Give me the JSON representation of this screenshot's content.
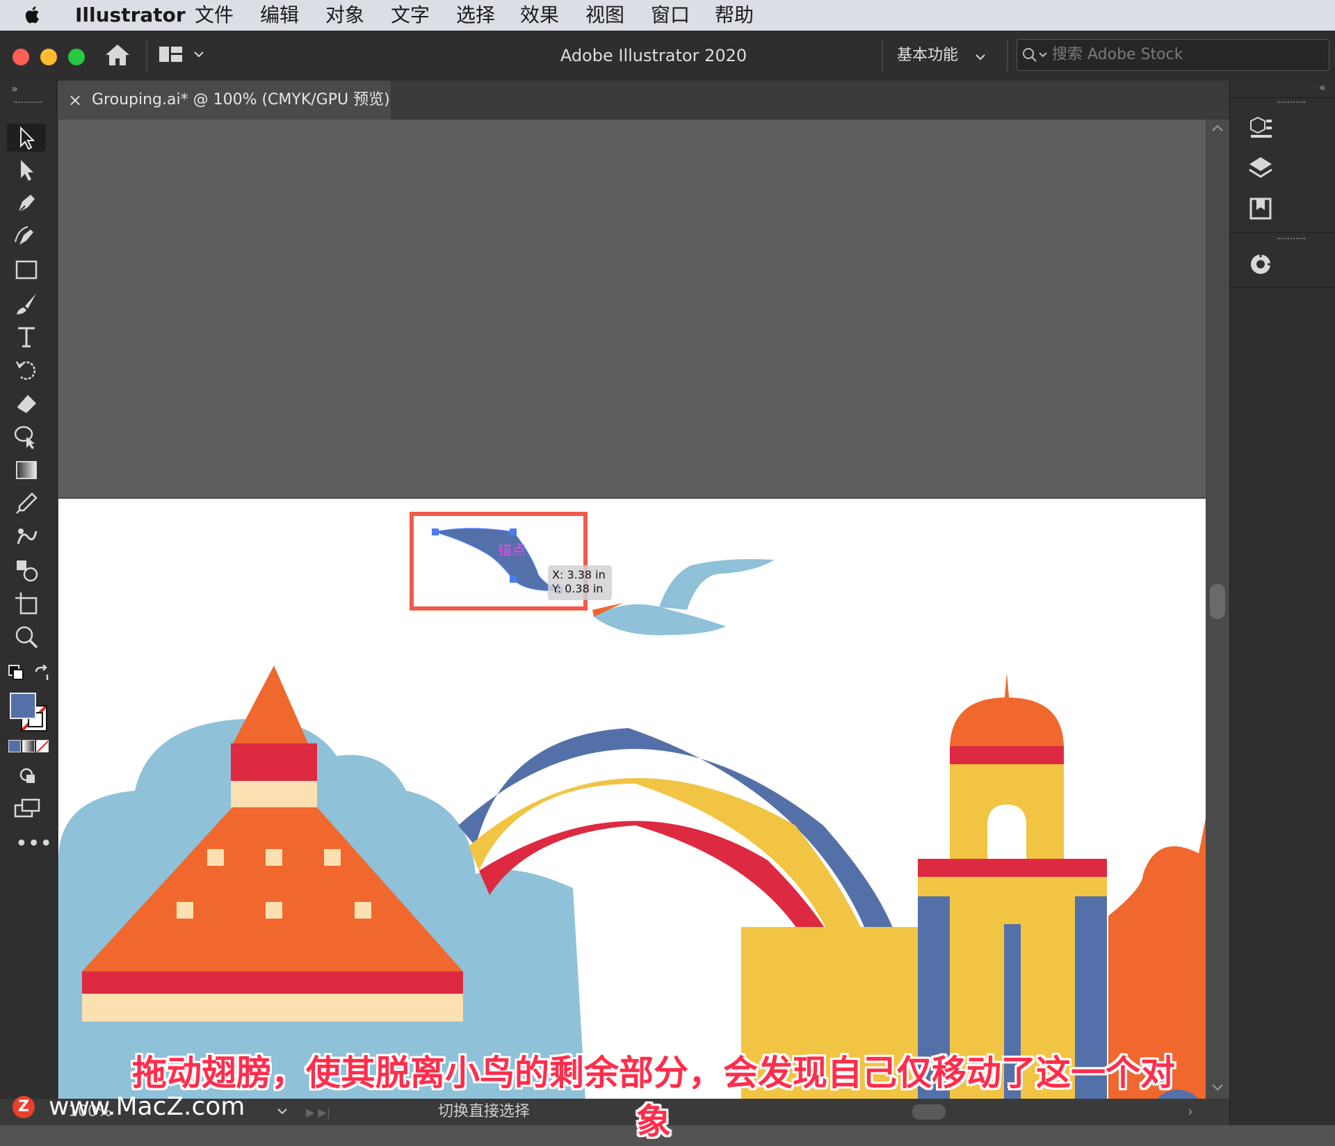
{
  "menubar": {
    "app_name": "Illustrator",
    "items": [
      "文件",
      "编辑",
      "对象",
      "文字",
      "选择",
      "效果",
      "视图",
      "窗口",
      "帮助"
    ]
  },
  "titlebar": {
    "title": "Adobe Illustrator 2020",
    "workspace": "基本功能",
    "search_placeholder": "搜索 Adobe Stock"
  },
  "document_tab": {
    "label": "Grouping.ai* @ 100% (CMYK/GPU 预览)"
  },
  "smart_guide": {
    "label": "锚点",
    "x_readout": "X: 3.38 in",
    "y_readout": "Y: 0.38 in"
  },
  "statusbar": {
    "zoom": "100%",
    "tool_hint": "切换直接选择"
  },
  "caption": "拖动翅膀，使其脱离小鸟的剩余部分，会发现自己仅移动了这一个对象",
  "watermark": "www.MacZ.com",
  "colors": {
    "selection": "#4a7cf0",
    "highlight_box": "#f15a4a",
    "fill_swatch": "#5470a8",
    "caption": "#ff2d4b"
  },
  "icons": {
    "tools": [
      "selection-tool-icon",
      "direct-selection-tool-icon",
      "pen-tool-icon",
      "curvature-tool-icon",
      "rectangle-tool-icon",
      "paintbrush-tool-icon",
      "type-tool-icon",
      "rotate-tool-icon",
      "eraser-tool-icon",
      "shape-builder-tool-icon",
      "gradient-tool-icon",
      "eyedropper-tool-icon",
      "puppet-warp-tool-icon",
      "symbol-sprayer-tool-icon",
      "artboard-tool-icon",
      "zoom-tool-icon"
    ],
    "right_panel": [
      "properties-icon",
      "layers-icon",
      "libraries-icon",
      "color-guide-icon"
    ]
  }
}
